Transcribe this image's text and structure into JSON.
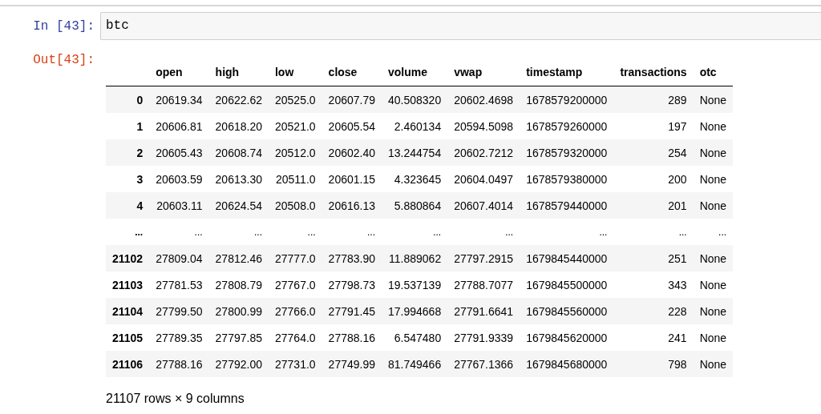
{
  "input_cell": {
    "prompt": "In [43]:",
    "code": "btc"
  },
  "output_cell": {
    "prompt": "Out[43]:",
    "table": {
      "columns": [
        "open",
        "high",
        "low",
        "close",
        "volume",
        "vwap",
        "timestamp",
        "transactions",
        "otc"
      ],
      "rows": [
        {
          "kind": "data",
          "index": "0",
          "cells": [
            "20619.34",
            "20622.62",
            "20525.0",
            "20607.79",
            "40.508320",
            "20602.4698",
            "1678579200000",
            "289",
            "None"
          ]
        },
        {
          "kind": "data",
          "index": "1",
          "cells": [
            "20606.81",
            "20618.20",
            "20521.0",
            "20605.54",
            "2.460134",
            "20594.5098",
            "1678579260000",
            "197",
            "None"
          ]
        },
        {
          "kind": "data",
          "index": "2",
          "cells": [
            "20605.43",
            "20608.74",
            "20512.0",
            "20602.40",
            "13.244754",
            "20602.7212",
            "1678579320000",
            "254",
            "None"
          ]
        },
        {
          "kind": "data",
          "index": "3",
          "cells": [
            "20603.59",
            "20613.30",
            "20511.0",
            "20601.15",
            "4.323645",
            "20604.0497",
            "1678579380000",
            "200",
            "None"
          ]
        },
        {
          "kind": "data",
          "index": "4",
          "cells": [
            "20603.11",
            "20624.54",
            "20508.0",
            "20616.13",
            "5.880864",
            "20607.4014",
            "1678579440000",
            "201",
            "None"
          ]
        },
        {
          "kind": "ellipsis",
          "index": "...",
          "cells": [
            "...",
            "...",
            "...",
            "...",
            "...",
            "...",
            "...",
            "...",
            "..."
          ]
        },
        {
          "kind": "data",
          "index": "21102",
          "cells": [
            "27809.04",
            "27812.46",
            "27777.0",
            "27783.90",
            "11.889062",
            "27797.2915",
            "1679845440000",
            "251",
            "None"
          ]
        },
        {
          "kind": "data",
          "index": "21103",
          "cells": [
            "27781.53",
            "27808.79",
            "27767.0",
            "27798.73",
            "19.537139",
            "27788.7077",
            "1679845500000",
            "343",
            "None"
          ]
        },
        {
          "kind": "data",
          "index": "21104",
          "cells": [
            "27799.50",
            "27800.99",
            "27766.0",
            "27791.45",
            "17.994668",
            "27791.6641",
            "1679845560000",
            "228",
            "None"
          ]
        },
        {
          "kind": "data",
          "index": "21105",
          "cells": [
            "27789.35",
            "27797.85",
            "27764.0",
            "27788.16",
            "6.547480",
            "27791.9339",
            "1679845620000",
            "241",
            "None"
          ]
        },
        {
          "kind": "data",
          "index": "21106",
          "cells": [
            "27788.16",
            "27792.00",
            "27731.0",
            "27749.99",
            "81.749466",
            "27767.1366",
            "1679845680000",
            "798",
            "None"
          ]
        }
      ]
    },
    "summary": "21107 rows × 9 columns"
  }
}
